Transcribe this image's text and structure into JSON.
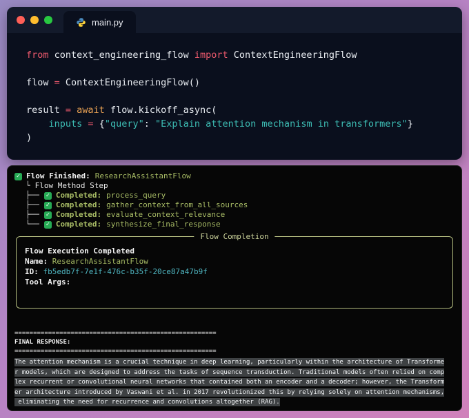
{
  "colors": {
    "background_gradient": [
      "#988ac2",
      "#b583c4",
      "#d082bb"
    ],
    "editor_bg": "#0a0f1d",
    "terminal_bg": "#060606",
    "keyword": "#ee5a6d",
    "operator": "#ee5a6d",
    "keyword_await": "#eaa254",
    "string": "#3dbdb4",
    "code_text": "#e9edf2",
    "success_green": "#27ab55",
    "flow_green": "#a9bd66",
    "id_teal": "#4fb5c0",
    "panel_border": "#b4bd80",
    "traffic_red": "#ff5f57",
    "traffic_yellow": "#ffbd2e",
    "traffic_green": "#28c841"
  },
  "editor": {
    "tab_label": "main.py",
    "window_controls": [
      "close",
      "minimize",
      "zoom"
    ],
    "code_lines": [
      [
        [
          "kw",
          "from"
        ],
        [
          "pl",
          " context_engineering_flow "
        ],
        [
          "kw",
          "import"
        ],
        [
          "pl",
          " ContextEngineeringFlow"
        ]
      ],
      [],
      [
        [
          "pl",
          "flow "
        ],
        [
          "op",
          "="
        ],
        [
          "pl",
          " ContextEngineeringFlow()"
        ]
      ],
      [],
      [
        [
          "pl",
          "result "
        ],
        [
          "op",
          "="
        ],
        [
          "aw",
          " await"
        ],
        [
          "pl",
          " flow.kickoff_async("
        ]
      ],
      [
        [
          "pl",
          "    "
        ],
        [
          "st",
          "inputs"
        ],
        [
          "op",
          " ="
        ],
        [
          "pl",
          " {"
        ],
        [
          "st",
          "\"query\""
        ],
        [
          "pl",
          ": "
        ],
        [
          "st",
          "\"Explain attention mechanism in transformers\""
        ],
        [
          "pl",
          "}"
        ]
      ],
      [
        [
          "pl",
          ")"
        ]
      ]
    ]
  },
  "terminal": {
    "flow_finished": {
      "label": "Flow Finished:",
      "value": "ResearchAssistantFlow"
    },
    "method_step": {
      "prefix": "└",
      "label": "Flow Method Step"
    },
    "steps": [
      {
        "prefix": "├──",
        "label": "Completed:",
        "value": "process_query"
      },
      {
        "prefix": "├──",
        "label": "Completed:",
        "value": "gather_context_from_all_sources"
      },
      {
        "prefix": "├──",
        "label": "Completed:",
        "value": "evaluate_context_relevance"
      },
      {
        "prefix": "└──",
        "label": "Completed:",
        "value": "synthesize_final_response"
      }
    ],
    "completion_panel": {
      "title": "Flow Completion",
      "rows": [
        {
          "label": "Flow Execution Completed",
          "value": "",
          "style": "green"
        },
        {
          "label": "Name:",
          "value": "ResearchAssistantFlow",
          "style": "green"
        },
        {
          "label": "ID:",
          "value": "fb5edb7f-7e1f-476c-b35f-20ce87a47b9f",
          "style": "teal"
        },
        {
          "label": "Tool Args:",
          "value": "",
          "style": "green"
        }
      ]
    },
    "separator": "======================================================",
    "final_response_label": "FINAL RESPONSE:",
    "response_lines": [
      "The attention mechanism is a crucial technique in deep learning, particularly within the architecture of Transforme",
      "r models, which are designed to address the tasks of sequence transduction. Traditional models often relied on comp",
      "lex recurrent or convolutional neural networks that contained both an encoder and a decoder; however, the Transform",
      "er architecture introduced by Vaswani et al. in 2017 revolutionized this by relying solely on attention mechanisms,",
      " eliminating the need for recurrence and convolutions altogether (RAG)."
    ]
  }
}
